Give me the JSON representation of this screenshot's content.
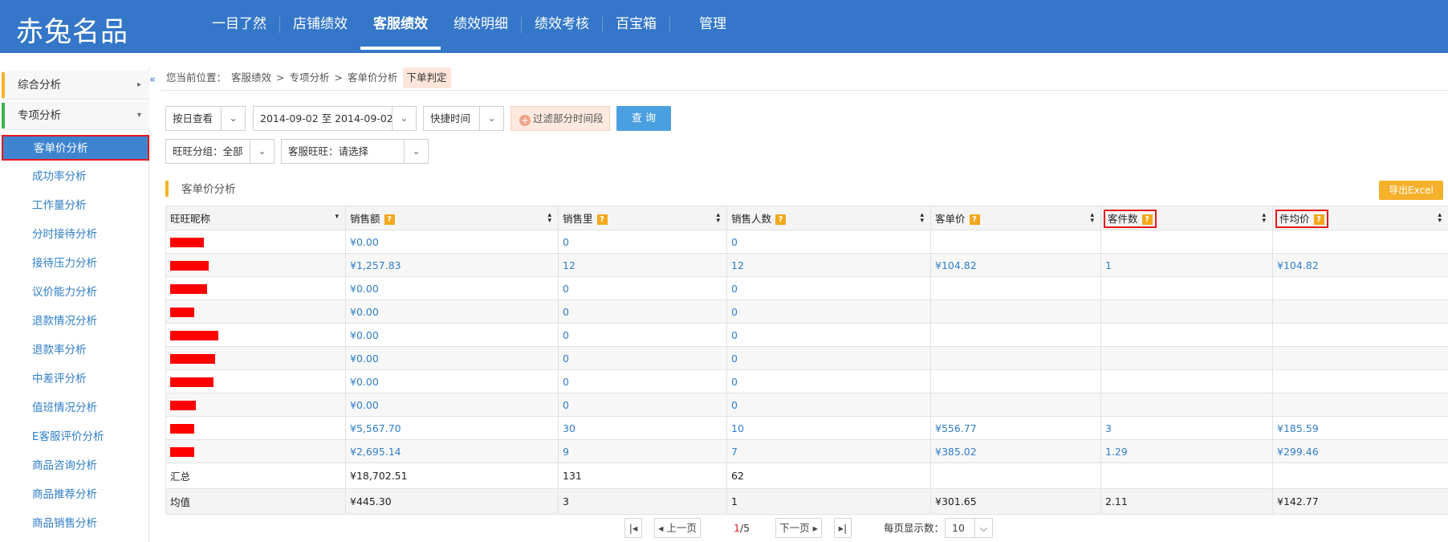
{
  "app": {
    "logo": "赤兔名品"
  },
  "nav": [
    {
      "label": "一目了然"
    },
    {
      "label": "店铺绩效"
    },
    {
      "label": "客服绩效"
    },
    {
      "label": "绩效明细"
    },
    {
      "label": "绩效考核"
    },
    {
      "label": "百宝箱"
    },
    {
      "label": "管理"
    }
  ],
  "sidebar": {
    "collapse_glyph": "«",
    "groups": [
      {
        "label": "综合分析",
        "arrow": "▸"
      },
      {
        "label": "专项分析",
        "arrow": "▾"
      }
    ],
    "items": [
      {
        "label": "客单价分析"
      },
      {
        "label": "成功率分析"
      },
      {
        "label": "工作量分析"
      },
      {
        "label": "分时接待分析"
      },
      {
        "label": "接待压力分析"
      },
      {
        "label": "议价能力分析"
      },
      {
        "label": "退款情况分析"
      },
      {
        "label": "退款率分析"
      },
      {
        "label": "中差评分析"
      },
      {
        "label": "值班情况分析"
      },
      {
        "label": "E客服评价分析"
      },
      {
        "label": "商品咨询分析"
      },
      {
        "label": "商品推荐分析"
      },
      {
        "label": "商品销售分析"
      }
    ]
  },
  "breadcrumb": {
    "prefix": "您当前位置：",
    "items": [
      "客服绩效",
      "专项分析",
      "客单价分析"
    ],
    "sep": ">",
    "current": "下单判定"
  },
  "filters": {
    "view_mode": "按日查看",
    "date_range": "2014-09-02 至 2014-09-02",
    "quick_time": "快捷时间",
    "filter_button": "过滤部分时间段",
    "query_button": "查 询",
    "group": "旺旺分组：全部",
    "agent": "客服旺旺：请选择"
  },
  "section": {
    "title": "客单价分析",
    "export": "导出Excel"
  },
  "table": {
    "help_glyph": "?",
    "columns": [
      "旺旺昵称",
      "销售额",
      "销售里",
      "销售人数",
      "客单价",
      "客件数",
      "件均价"
    ],
    "rows": [
      {
        "redact_w": 42,
        "sales": "¥0.00",
        "qty": "0",
        "buyers": "0",
        "unit_price": "",
        "items_per": "",
        "avg_price": ""
      },
      {
        "redact_w": 48,
        "sales": "¥1,257.83",
        "qty": "12",
        "buyers": "12",
        "unit_price": "¥104.82",
        "items_per": "1",
        "avg_price": "¥104.82"
      },
      {
        "redact_w": 46,
        "sales": "¥0.00",
        "qty": "0",
        "buyers": "0",
        "unit_price": "",
        "items_per": "",
        "avg_price": ""
      },
      {
        "redact_w": 30,
        "sales": "¥0.00",
        "qty": "0",
        "buyers": "0",
        "unit_price": "",
        "items_per": "",
        "avg_price": ""
      },
      {
        "redact_w": 60,
        "sales": "¥0.00",
        "qty": "0",
        "buyers": "0",
        "unit_price": "",
        "items_per": "",
        "avg_price": ""
      },
      {
        "redact_w": 56,
        "sales": "¥0.00",
        "qty": "0",
        "buyers": "0",
        "unit_price": "",
        "items_per": "",
        "avg_price": ""
      },
      {
        "redact_w": 54,
        "sales": "¥0.00",
        "qty": "0",
        "buyers": "0",
        "unit_price": "",
        "items_per": "",
        "avg_price": ""
      },
      {
        "redact_w": 32,
        "sales": "¥0.00",
        "qty": "0",
        "buyers": "0",
        "unit_price": "",
        "items_per": "",
        "avg_price": ""
      },
      {
        "redact_w": 30,
        "sales": "¥5,567.70",
        "qty": "30",
        "buyers": "10",
        "unit_price": "¥556.77",
        "items_per": "3",
        "avg_price": "¥185.59"
      },
      {
        "redact_w": 30,
        "sales": "¥2,695.14",
        "qty": "9",
        "buyers": "7",
        "unit_price": "¥385.02",
        "items_per": "1.29",
        "avg_price": "¥299.46"
      }
    ],
    "summary": [
      {
        "label": "汇总",
        "sales": "¥18,702.51",
        "qty": "131",
        "buyers": "62",
        "unit_price": "",
        "items_per": "",
        "avg_price": ""
      },
      {
        "label": "均值",
        "sales": "¥445.30",
        "qty": "3",
        "buyers": "1",
        "unit_price": "¥301.65",
        "items_per": "2.11",
        "avg_price": "¥142.77"
      }
    ]
  },
  "pagination": {
    "first": "|◂",
    "prev": "◂ 上一页",
    "current_page": "1",
    "total_pages": "/5",
    "next": "下一页 ▸",
    "last": "▸|",
    "page_size_label": "每页显示数：",
    "page_size": "10",
    "dropdown_glyph": "⌵"
  },
  "colors": {
    "nav_bg": "#3477c8",
    "active_item_bg": "#3d85cf",
    "highlight_border": "#e41a1c",
    "help_badge": "#f2a81d",
    "export_button": "#f5b12b",
    "query_button": "#4a9fe0"
  }
}
